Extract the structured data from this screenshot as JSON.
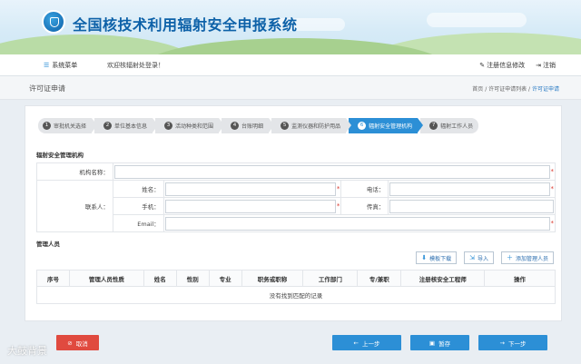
{
  "header": {
    "system_title": "全国核技术利用辐射安全申报系统",
    "logo_icon": "agency-emblem"
  },
  "nav": {
    "menu_label": "系统菜单",
    "welcome": "欢迎核辐射处登录！",
    "reg_info_label": "注册信息修改",
    "logout_label": "注销"
  },
  "page": {
    "title": "许可证申请",
    "breadcrumb": [
      "首页",
      "许可证申请列表",
      "许可证申请"
    ],
    "breadcrumb_sep": " / "
  },
  "steps": [
    {
      "num": "1",
      "label": "审批机关选择",
      "active": false
    },
    {
      "num": "2",
      "label": "单位基本信息",
      "active": false
    },
    {
      "num": "3",
      "label": "活动种类和范围",
      "active": false
    },
    {
      "num": "4",
      "label": "台账明细",
      "active": false
    },
    {
      "num": "5",
      "label": "监测仪器和防护用品",
      "active": false
    },
    {
      "num": "6",
      "label": "辐射安全管理机构",
      "active": true
    },
    {
      "num": "7",
      "label": "辐射工作人员",
      "active": false
    }
  ],
  "org_section": {
    "title": "辐射安全管理机构",
    "org_name_label": "机构名称：",
    "contact_label": "联系人：",
    "name_label": "姓名：",
    "phone_label": "电话：",
    "mobile_label": "手机：",
    "fax_label": "传真：",
    "email_label": "Email：",
    "required_mark": "*"
  },
  "staff_section": {
    "title": "管理人员",
    "toolbar": {
      "template_download": "模板下载",
      "import": "导入",
      "add_staff": "添加管理人员"
    },
    "columns": [
      "序号",
      "管理人员性质",
      "姓名",
      "性别",
      "专业",
      "职务或职称",
      "工作部门",
      "专/兼职",
      "注册核安全工程师",
      "操作"
    ],
    "empty_text": "没有找到匹配的记录"
  },
  "actions": {
    "cancel": "取消",
    "prev": "上一步",
    "save": "暂存",
    "next": "下一步"
  },
  "watermark": "大鼓背景",
  "colors": {
    "primary": "#2c8fd6",
    "danger": "#e04a3f",
    "title_blue": "#0d61a8"
  }
}
